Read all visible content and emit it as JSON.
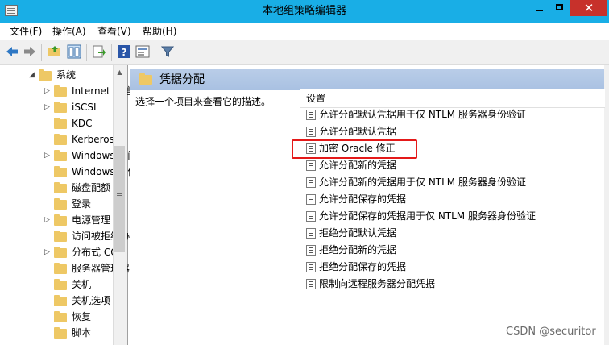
{
  "window": {
    "title": "本地组策略编辑器",
    "close_glyph": "✕"
  },
  "menu": [
    "文件(F)",
    "操作(A)",
    "查看(V)",
    "帮助(H)"
  ],
  "toolbar": {
    "icons": [
      "back-arrow-icon",
      "forward-arrow-icon",
      "up-folder-icon",
      "show-hide-tree-icon",
      "export-list-icon",
      "help-icon",
      "properties-icon",
      "filter-icon"
    ]
  },
  "tree": {
    "items": [
      {
        "label": "系统",
        "expanded": true
      },
      {
        "label": "Internet 通信管理",
        "expandable": true
      },
      {
        "label": "iSCSI",
        "expandable": true
      },
      {
        "label": "KDC",
        "expandable": false
      },
      {
        "label": "Kerberos",
        "expandable": false
      },
      {
        "label": "Windows 时间服务",
        "expandable": true
      },
      {
        "label": "Windows 文件保护",
        "expandable": false
      },
      {
        "label": "磁盘配额",
        "expandable": false
      },
      {
        "label": "登录",
        "expandable": false
      },
      {
        "label": "电源管理",
        "expandable": true
      },
      {
        "label": "访问被拒绝协助",
        "expandable": false
      },
      {
        "label": "分布式 COM",
        "expandable": true
      },
      {
        "label": "服务器管理器",
        "expandable": false
      },
      {
        "label": "关机",
        "expandable": false
      },
      {
        "label": "关机选项",
        "expandable": false
      },
      {
        "label": "恢复",
        "expandable": false
      },
      {
        "label": "脚本",
        "expandable": false
      }
    ],
    "scroll_up_glyph": "▲",
    "grip_glyph": "≡"
  },
  "content": {
    "header_title": "凭据分配",
    "description": "选择一个项目来查看它的描述。",
    "column_header": "设置",
    "settings": [
      "允许分配默认凭据用于仅 NTLM 服务器身份验证",
      "允许分配默认凭据",
      "加密 Oracle 修正",
      "允许分配新的凭据",
      "允许分配新的凭据用于仅 NTLM 服务器身份验证",
      "允许分配保存的凭据",
      "允许分配保存的凭据用于仅 NTLM 服务器身份验证",
      "拒绝分配默认凭据",
      "拒绝分配新的凭据",
      "拒绝分配保存的凭据",
      "限制向远程服务器分配凭据"
    ],
    "highlighted_index": 2
  },
  "watermark": "CSDN @securitor",
  "colors": {
    "titlebar": "#19aee6",
    "close": "#c7312b",
    "highlight": "#e41919",
    "header_band": "#b4c9e6"
  }
}
